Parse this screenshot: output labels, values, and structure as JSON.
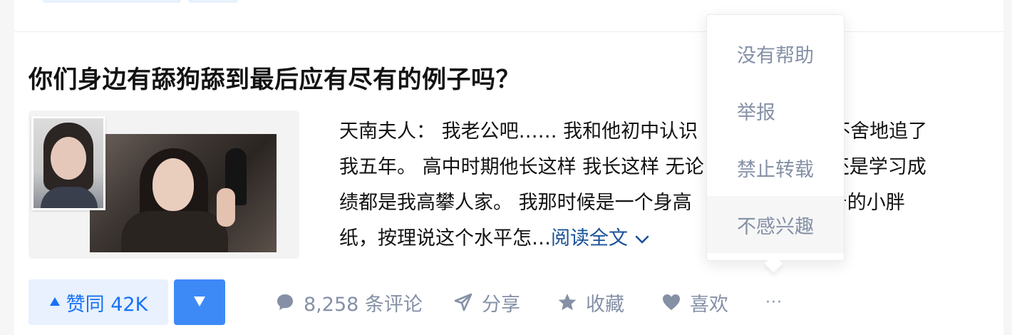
{
  "question": {
    "title": "你们身边有舔狗舔到最后应有尽有的例子吗？"
  },
  "answer": {
    "excerpt_lines": [
      "天南夫人： 我老公吧…… 我和他初中认识",
      "我五年。 高中时期他长这样 我长这样 无论",
      "绩都是我高攀人家。 我那时候是一个身高",
      "纸，按理说这个水平怎…"
    ],
    "excerpt_line1_tail": "而不舍地追了",
    "excerpt_line2_tail": "境还是学习成",
    "excerpt_line3_tail": "5斤的小胖",
    "read_more": "阅读全文",
    "thumbnail_icon": "photo-collage"
  },
  "actions": {
    "upvote_label": "赞同 42K",
    "upvote_icon": "triangle-up-icon",
    "downvote_icon": "triangle-down-icon",
    "comments": "8,258 条评论",
    "share": "分享",
    "favorite": "收藏",
    "like": "喜欢",
    "more": "···"
  },
  "more_menu": {
    "items": [
      "没有帮助",
      "举报",
      "禁止转载",
      "不感兴趣"
    ]
  },
  "colors": {
    "accent": "#1772f6",
    "link": "#175199",
    "muted": "#8590a6",
    "upvote_bg": "#e8f1fd",
    "downvote_bg": "#3d8af7"
  }
}
